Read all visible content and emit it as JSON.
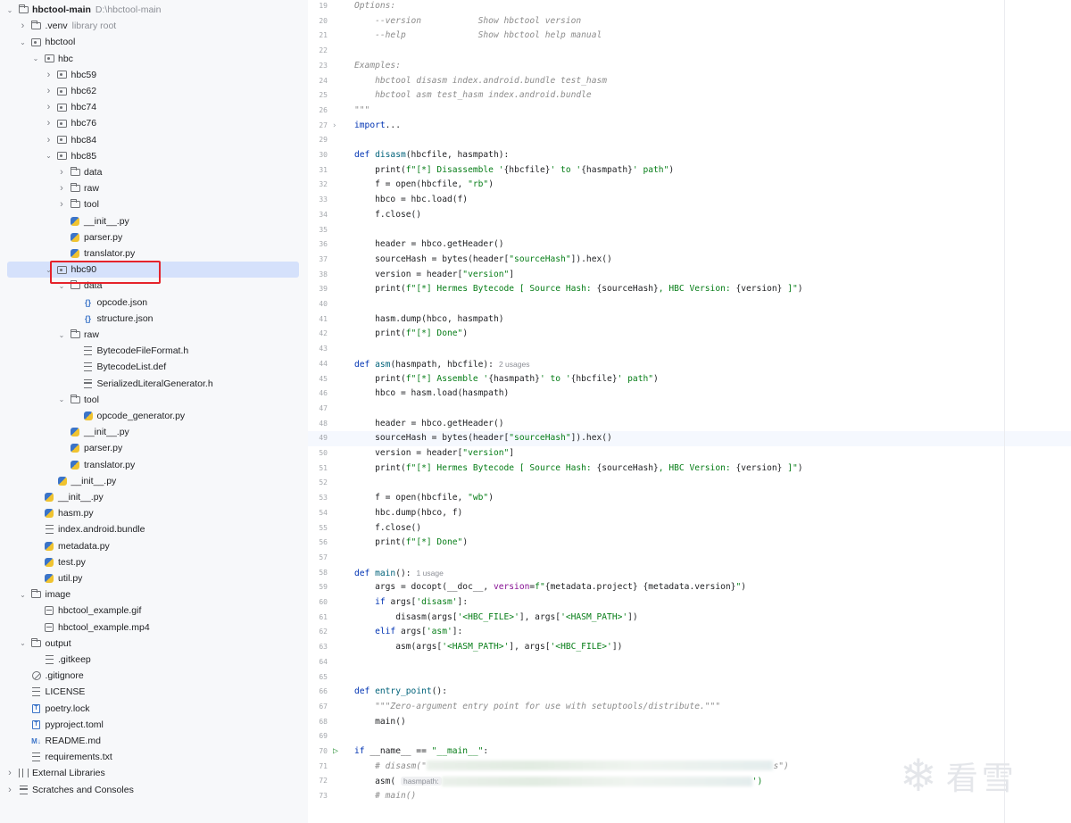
{
  "project_tree": {
    "rows": [
      {
        "name": "hbctool-main",
        "hint": "D:\\hbctool-main",
        "depth": 0,
        "arrow": "open",
        "icon": "folder-icon",
        "bold": true
      },
      {
        "name": ".venv",
        "hint": "library root",
        "depth": 1,
        "arrow": "closed",
        "icon": "folder-icon"
      },
      {
        "name": "hbctool",
        "depth": 1,
        "arrow": "open",
        "icon": "package-icon"
      },
      {
        "name": "hbc",
        "depth": 2,
        "arrow": "open",
        "icon": "package-icon"
      },
      {
        "name": "hbc59",
        "depth": 3,
        "arrow": "closed",
        "icon": "package-icon"
      },
      {
        "name": "hbc62",
        "depth": 3,
        "arrow": "closed",
        "icon": "package-icon"
      },
      {
        "name": "hbc74",
        "depth": 3,
        "arrow": "closed",
        "icon": "package-icon"
      },
      {
        "name": "hbc76",
        "depth": 3,
        "arrow": "closed",
        "icon": "package-icon"
      },
      {
        "name": "hbc84",
        "depth": 3,
        "arrow": "closed",
        "icon": "package-icon"
      },
      {
        "name": "hbc85",
        "depth": 3,
        "arrow": "open",
        "icon": "package-icon"
      },
      {
        "name": "data",
        "depth": 4,
        "arrow": "closed",
        "icon": "folder-icon"
      },
      {
        "name": "raw",
        "depth": 4,
        "arrow": "closed",
        "icon": "folder-icon"
      },
      {
        "name": "tool",
        "depth": 4,
        "arrow": "closed",
        "icon": "folder-icon"
      },
      {
        "name": "__init__.py",
        "depth": 4,
        "arrow": "none",
        "icon": "python-file-icon"
      },
      {
        "name": "parser.py",
        "depth": 4,
        "arrow": "none",
        "icon": "python-file-icon"
      },
      {
        "name": "translator.py",
        "depth": 4,
        "arrow": "none",
        "icon": "python-file-icon"
      },
      {
        "name": "hbc90",
        "depth": 3,
        "arrow": "open",
        "icon": "package-icon",
        "selected": true
      },
      {
        "name": "data",
        "depth": 4,
        "arrow": "open",
        "icon": "folder-icon"
      },
      {
        "name": "opcode.json",
        "depth": 5,
        "arrow": "none",
        "icon": "json-file-icon"
      },
      {
        "name": "structure.json",
        "depth": 5,
        "arrow": "none",
        "icon": "json-file-icon"
      },
      {
        "name": "raw",
        "depth": 4,
        "arrow": "open",
        "icon": "folder-icon"
      },
      {
        "name": "BytecodeFileFormat.h",
        "depth": 5,
        "arrow": "none",
        "icon": "text-file-icon"
      },
      {
        "name": "BytecodeList.def",
        "depth": 5,
        "arrow": "none",
        "icon": "text-file-icon"
      },
      {
        "name": "SerializedLiteralGenerator.h",
        "depth": 5,
        "arrow": "none",
        "icon": "text-file-icon"
      },
      {
        "name": "tool",
        "depth": 4,
        "arrow": "open",
        "icon": "folder-icon"
      },
      {
        "name": "opcode_generator.py",
        "depth": 5,
        "arrow": "none",
        "icon": "python-file-icon"
      },
      {
        "name": "__init__.py",
        "depth": 4,
        "arrow": "none",
        "icon": "python-file-icon"
      },
      {
        "name": "parser.py",
        "depth": 4,
        "arrow": "none",
        "icon": "python-file-icon"
      },
      {
        "name": "translator.py",
        "depth": 4,
        "arrow": "none",
        "icon": "python-file-icon"
      },
      {
        "name": "__init__.py",
        "depth": 3,
        "arrow": "none",
        "icon": "python-file-icon"
      },
      {
        "name": "__init__.py",
        "depth": 2,
        "arrow": "none",
        "icon": "python-file-icon"
      },
      {
        "name": "hasm.py",
        "depth": 2,
        "arrow": "none",
        "icon": "python-file-icon"
      },
      {
        "name": "index.android.bundle",
        "depth": 2,
        "arrow": "none",
        "icon": "bundle-file-icon"
      },
      {
        "name": "metadata.py",
        "depth": 2,
        "arrow": "none",
        "icon": "python-file-icon"
      },
      {
        "name": "test.py",
        "depth": 2,
        "arrow": "none",
        "icon": "python-file-icon"
      },
      {
        "name": "util.py",
        "depth": 2,
        "arrow": "none",
        "icon": "python-file-icon"
      },
      {
        "name": "image",
        "depth": 1,
        "arrow": "open",
        "icon": "folder-icon"
      },
      {
        "name": "hbctool_example.gif",
        "depth": 2,
        "arrow": "none",
        "icon": "image-file-icon"
      },
      {
        "name": "hbctool_example.mp4",
        "depth": 2,
        "arrow": "none",
        "icon": "image-file-icon"
      },
      {
        "name": "output",
        "depth": 1,
        "arrow": "open",
        "icon": "folder-icon"
      },
      {
        "name": ".gitkeep",
        "depth": 2,
        "arrow": "none",
        "icon": "text-file-icon"
      },
      {
        "name": ".gitignore",
        "depth": 1,
        "arrow": "none",
        "icon": "gitignore-icon"
      },
      {
        "name": "LICENSE",
        "depth": 1,
        "arrow": "none",
        "icon": "text-file-icon"
      },
      {
        "name": "poetry.lock",
        "depth": 1,
        "arrow": "none",
        "icon": "toml-file-icon"
      },
      {
        "name": "pyproject.toml",
        "depth": 1,
        "arrow": "none",
        "icon": "toml-file-icon"
      },
      {
        "name": "README.md",
        "depth": 1,
        "arrow": "none",
        "icon": "markdown-file-icon"
      },
      {
        "name": "requirements.txt",
        "depth": 1,
        "arrow": "none",
        "icon": "text-file-icon"
      },
      {
        "name": "External Libraries",
        "depth": 0,
        "arrow": "closed",
        "icon": "library-icon"
      },
      {
        "name": "Scratches and Consoles",
        "depth": 0,
        "arrow": "closed",
        "icon": "scratch-icon"
      }
    ]
  },
  "editor": {
    "current_line": 49,
    "lines": [
      {
        "n": 19,
        "t": [
          [
            "dc",
            "Options:"
          ]
        ]
      },
      {
        "n": 20,
        "t": [
          [
            "dc",
            "    --version           Show hbctool version"
          ]
        ]
      },
      {
        "n": 21,
        "t": [
          [
            "dc",
            "    --help              Show hbctool help manual"
          ]
        ]
      },
      {
        "n": 22,
        "t": []
      },
      {
        "n": 23,
        "t": [
          [
            "dc",
            "Examples:"
          ]
        ]
      },
      {
        "n": 24,
        "t": [
          [
            "dc",
            "    hbctool disasm index.android.bundle test_hasm"
          ]
        ]
      },
      {
        "n": 25,
        "t": [
          [
            "dc",
            "    hbctool asm test_hasm index.android.bundle"
          ]
        ]
      },
      {
        "n": 26,
        "t": [
          [
            "dc",
            "\"\"\""
          ]
        ]
      },
      {
        "n": 27,
        "fold": true,
        "t": [
          [
            "kw",
            "import"
          ],
          [
            "",
            "..."
          ]
        ]
      },
      {
        "n": 29,
        "t": []
      },
      {
        "n": 30,
        "t": [
          [
            "kw",
            "def "
          ],
          [
            "fn",
            "disasm"
          ],
          [
            "",
            "(hbcfile, hasmpath):"
          ]
        ]
      },
      {
        "n": 31,
        "t": [
          [
            "",
            "    print("
          ],
          [
            "st",
            "f\"[*] Disassemble '"
          ],
          [
            "",
            "{hbcfile}"
          ],
          [
            "st",
            "' to '"
          ],
          [
            "",
            "{hasmpath}"
          ],
          [
            "st",
            "' path\""
          ],
          [
            "",
            ")"
          ]
        ]
      },
      {
        "n": 32,
        "t": [
          [
            "",
            "    f = open(hbcfile, "
          ],
          [
            "st",
            "\"rb\""
          ],
          [
            "",
            ")"
          ]
        ]
      },
      {
        "n": 33,
        "t": [
          [
            "",
            "    hbco = hbc.load(f)"
          ]
        ]
      },
      {
        "n": 34,
        "t": [
          [
            "",
            "    f.close()"
          ]
        ]
      },
      {
        "n": 35,
        "t": []
      },
      {
        "n": 36,
        "t": [
          [
            "",
            "    header = hbco.getHeader()"
          ]
        ]
      },
      {
        "n": 37,
        "t": [
          [
            "",
            "    sourceHash = bytes(header["
          ],
          [
            "st",
            "\"sourceHash\""
          ],
          [
            "",
            "]).hex()"
          ]
        ]
      },
      {
        "n": 38,
        "t": [
          [
            "",
            "    version = header["
          ],
          [
            "st",
            "\"version\""
          ],
          [
            "",
            "]"
          ]
        ]
      },
      {
        "n": 39,
        "t": [
          [
            "",
            "    print("
          ],
          [
            "st",
            "f\"[*] Hermes Bytecode [ Source Hash: "
          ],
          [
            "",
            "{sourceHash}"
          ],
          [
            "st",
            ", HBC Version: "
          ],
          [
            "",
            "{version}"
          ],
          [
            "st",
            " ]\""
          ],
          [
            "",
            ")"
          ]
        ]
      },
      {
        "n": 40,
        "t": []
      },
      {
        "n": 41,
        "t": [
          [
            "",
            "    hasm.dump(hbco, hasmpath)"
          ]
        ]
      },
      {
        "n": 42,
        "t": [
          [
            "",
            "    print("
          ],
          [
            "st",
            "f\"[*] Done\""
          ],
          [
            "",
            ")"
          ]
        ]
      },
      {
        "n": 43,
        "t": []
      },
      {
        "n": 44,
        "hint": "2 usages",
        "t": [
          [
            "kw",
            "def "
          ],
          [
            "fn",
            "asm"
          ],
          [
            "",
            "(hasmpath, hbcfile):"
          ]
        ]
      },
      {
        "n": 45,
        "t": [
          [
            "",
            "    print("
          ],
          [
            "st",
            "f\"[*] Assemble '"
          ],
          [
            "",
            "{hasmpath}"
          ],
          [
            "st",
            "' to '"
          ],
          [
            "",
            "{hbcfile}"
          ],
          [
            "st",
            "' path\""
          ],
          [
            "",
            ")"
          ]
        ]
      },
      {
        "n": 46,
        "t": [
          [
            "",
            "    hbco = hasm.load(hasmpath)"
          ]
        ]
      },
      {
        "n": 47,
        "t": []
      },
      {
        "n": 48,
        "t": [
          [
            "",
            "    header = hbco.getHeader()"
          ]
        ]
      },
      {
        "n": 49,
        "t": [
          [
            "",
            "    sourceHash = bytes(header["
          ],
          [
            "st",
            "\"sourceHash\""
          ],
          [
            "",
            "]).hex()"
          ]
        ]
      },
      {
        "n": 50,
        "t": [
          [
            "",
            "    version = header["
          ],
          [
            "st",
            "\"version\""
          ],
          [
            "",
            "]"
          ]
        ]
      },
      {
        "n": 51,
        "t": [
          [
            "",
            "    print("
          ],
          [
            "st",
            "f\"[*] Hermes Bytecode [ Source Hash: "
          ],
          [
            "",
            "{sourceHash}"
          ],
          [
            "st",
            ", HBC Version: "
          ],
          [
            "",
            "{version}"
          ],
          [
            "st",
            " ]\""
          ],
          [
            "",
            ")"
          ]
        ]
      },
      {
        "n": 52,
        "t": []
      },
      {
        "n": 53,
        "t": [
          [
            "",
            "    f = open(hbcfile, "
          ],
          [
            "st",
            "\"wb\""
          ],
          [
            "",
            ")"
          ]
        ]
      },
      {
        "n": 54,
        "t": [
          [
            "",
            "    hbc.dump(hbco, f)"
          ]
        ]
      },
      {
        "n": 55,
        "t": [
          [
            "",
            "    f.close()"
          ]
        ]
      },
      {
        "n": 56,
        "t": [
          [
            "",
            "    print("
          ],
          [
            "st",
            "f\"[*] Done\""
          ],
          [
            "",
            ")"
          ]
        ]
      },
      {
        "n": 57,
        "t": []
      },
      {
        "n": 58,
        "hint": "1 usage",
        "t": [
          [
            "kw",
            "def "
          ],
          [
            "fn",
            "main"
          ],
          [
            "",
            "():"
          ]
        ]
      },
      {
        "n": 59,
        "t": [
          [
            "",
            "    args = docopt(__doc__, "
          ],
          [
            "pm",
            "version"
          ],
          [
            "",
            "="
          ],
          [
            "st",
            "f\""
          ],
          [
            "",
            "{metadata.project} {metadata.version}"
          ],
          [
            "st",
            "\""
          ],
          [
            "",
            ")"
          ]
        ]
      },
      {
        "n": 60,
        "t": [
          [
            "kw",
            "    if "
          ],
          [
            "",
            "args["
          ],
          [
            "st",
            "'disasm'"
          ],
          [
            "",
            "]:"
          ]
        ]
      },
      {
        "n": 61,
        "t": [
          [
            "",
            "        disasm(args["
          ],
          [
            "st",
            "'<HBC_FILE>'"
          ],
          [
            "",
            "], args["
          ],
          [
            "st",
            "'<HASM_PATH>'"
          ],
          [
            "",
            "])"
          ]
        ]
      },
      {
        "n": 62,
        "t": [
          [
            "kw",
            "    elif "
          ],
          [
            "",
            "args["
          ],
          [
            "st",
            "'asm'"
          ],
          [
            "",
            "]:"
          ]
        ]
      },
      {
        "n": 63,
        "t": [
          [
            "",
            "        asm(args["
          ],
          [
            "st",
            "'<HASM_PATH>'"
          ],
          [
            "",
            "], args["
          ],
          [
            "st",
            "'<HBC_FILE>'"
          ],
          [
            "",
            "])"
          ]
        ]
      },
      {
        "n": 64,
        "t": []
      },
      {
        "n": 65,
        "t": []
      },
      {
        "n": 66,
        "t": [
          [
            "kw",
            "def "
          ],
          [
            "fn",
            "entry_point"
          ],
          [
            "",
            "():"
          ]
        ]
      },
      {
        "n": 67,
        "t": [
          [
            "dc",
            "    \"\"\"Zero-argument entry point for use with setuptools/distribute.\"\"\""
          ]
        ]
      },
      {
        "n": 68,
        "t": [
          [
            "",
            "    main()"
          ]
        ]
      },
      {
        "n": 69,
        "t": []
      },
      {
        "n": 70,
        "run": true,
        "t": [
          [
            "kw",
            "if "
          ],
          [
            "",
            "__name__ == "
          ],
          [
            "st",
            "\"__main__\""
          ],
          [
            "",
            ":"
          ]
        ]
      },
      {
        "n": 71,
        "t": [
          [
            "cm",
            "    # disasm(\""
          ],
          [
            "blur",
            "                                                                   "
          ],
          [
            "cm",
            "s\")"
          ]
        ]
      },
      {
        "n": 72,
        "t": [
          [
            "",
            "    asm( "
          ],
          [
            "iw",
            "hasmpath:"
          ],
          [
            "blur",
            "                                                            "
          ],
          [
            "st",
            "')"
          ]
        ]
      },
      {
        "n": 73,
        "t": [
          [
            "cm",
            "    # main()"
          ]
        ]
      }
    ]
  },
  "watermark": {
    "flake": "❄",
    "text": "看雪"
  }
}
